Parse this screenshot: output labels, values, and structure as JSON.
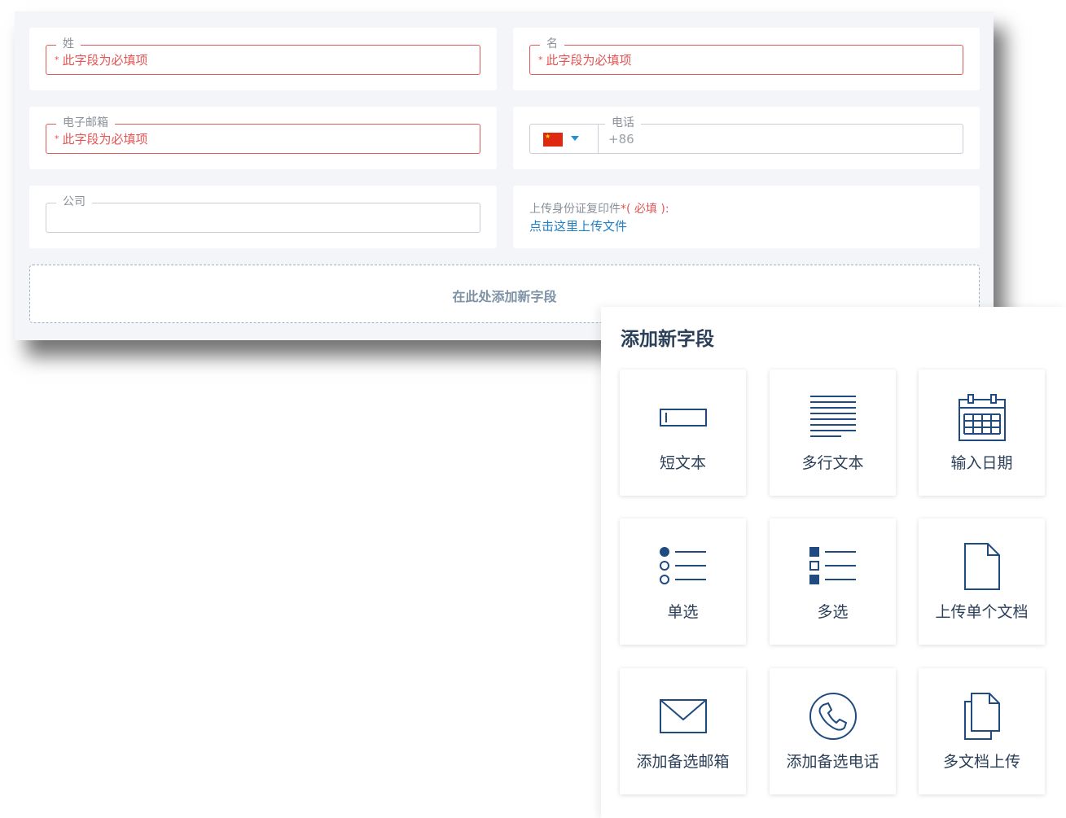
{
  "form": {
    "last_name": {
      "legend": "姓",
      "error": "此字段为必填项"
    },
    "first_name": {
      "legend": "名",
      "error": "此字段为必填项"
    },
    "email": {
      "legend": "电子邮箱",
      "error": "此字段为必填项"
    },
    "phone": {
      "legend": "电话",
      "value": "+86",
      "flag": "china-flag-icon"
    },
    "company": {
      "legend": "公司",
      "value": ""
    },
    "id_upload": {
      "label": "上传身份证复印件",
      "required_star": "*",
      "required_text": "( 必填 ):",
      "link": "点击这里上传文件"
    },
    "add_field": "在此处添加新字段"
  },
  "popup": {
    "title": "添加新字段",
    "tiles": [
      {
        "label": "短文本",
        "icon": "short-text-icon"
      },
      {
        "label": "多行文本",
        "icon": "multiline-text-icon"
      },
      {
        "label": "输入日期",
        "icon": "calendar-icon"
      },
      {
        "label": "单选",
        "icon": "radio-list-icon"
      },
      {
        "label": "多选",
        "icon": "checkbox-list-icon"
      },
      {
        "label": "上传单个文档",
        "icon": "document-icon"
      },
      {
        "label": "添加备选邮箱",
        "icon": "envelope-icon"
      },
      {
        "label": "添加备选电话",
        "icon": "phone-icon"
      },
      {
        "label": "多文档上传",
        "icon": "documents-icon"
      }
    ]
  },
  "colors": {
    "error": "#e25555",
    "link": "#1e7fc4",
    "icon": "#1f4b80",
    "title": "#2b3f58"
  }
}
